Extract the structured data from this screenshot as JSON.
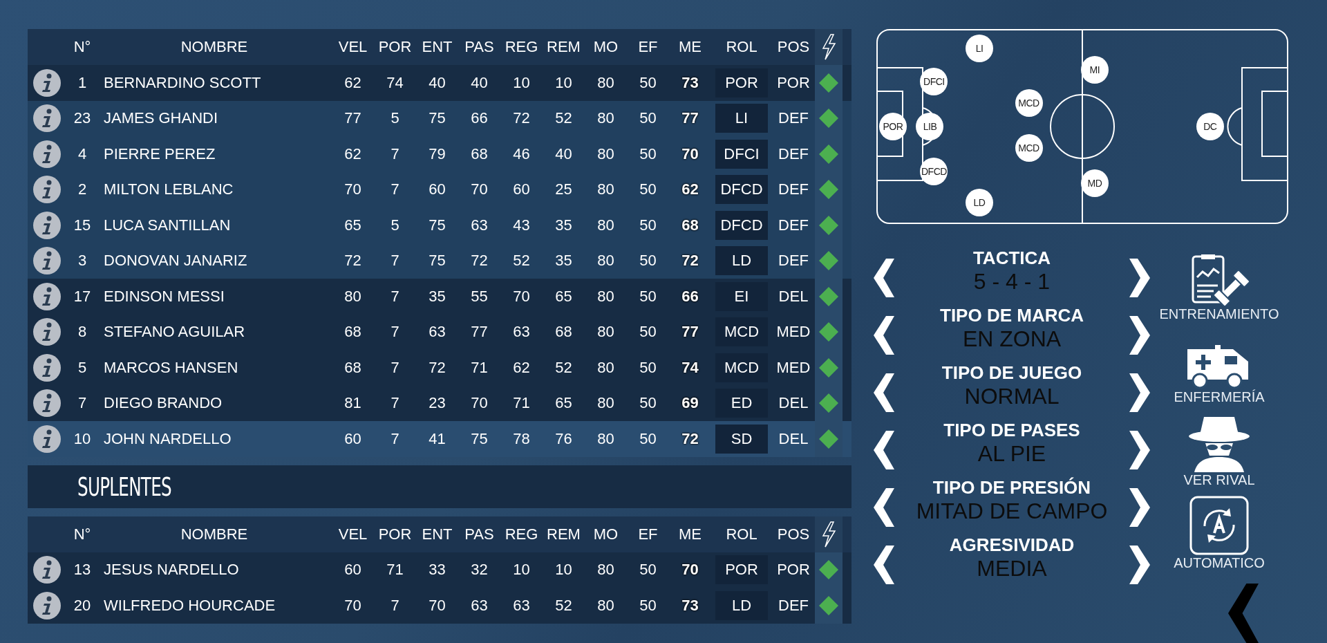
{
  "columns": [
    "N°",
    "NOMBRE",
    "VEL",
    "POR",
    "ENT",
    "PAS",
    "REG",
    "REM",
    "MO",
    "EF",
    "ME",
    "ROL",
    "POS"
  ],
  "starters": [
    {
      "number": "1",
      "name": "BERNARDINO SCOTT",
      "stats": [
        "62",
        "74",
        "40",
        "40",
        "10",
        "10",
        "80",
        "50"
      ],
      "me": "73",
      "rol": "POR",
      "pos": "POR",
      "kind": "dark"
    },
    {
      "number": "23",
      "name": "JAMES GHANDI",
      "stats": [
        "77",
        "5",
        "75",
        "66",
        "72",
        "52",
        "80",
        "50"
      ],
      "me": "77",
      "rol": "LI",
      "pos": "DEF",
      "kind": "mid"
    },
    {
      "number": "4",
      "name": "PIERRE PEREZ",
      "stats": [
        "62",
        "7",
        "79",
        "68",
        "46",
        "40",
        "80",
        "50"
      ],
      "me": "70",
      "rol": "DFCI",
      "pos": "DEF",
      "kind": "mid"
    },
    {
      "number": "2",
      "name": "MILTON LEBLANC",
      "stats": [
        "70",
        "7",
        "60",
        "70",
        "60",
        "25",
        "80",
        "50"
      ],
      "me": "62",
      "rol": "DFCD",
      "pos": "DEF",
      "kind": "mid"
    },
    {
      "number": "15",
      "name": "LUCA SANTILLAN",
      "stats": [
        "65",
        "5",
        "75",
        "63",
        "43",
        "35",
        "80",
        "50"
      ],
      "me": "68",
      "rol": "DFCD",
      "pos": "DEF",
      "kind": "mid"
    },
    {
      "number": "3",
      "name": "DONOVAN JANARIZ",
      "stats": [
        "72",
        "7",
        "75",
        "72",
        "52",
        "35",
        "80",
        "50"
      ],
      "me": "72",
      "rol": "LD",
      "pos": "DEF",
      "kind": "mid"
    },
    {
      "number": "17",
      "name": "EDINSON MESSI",
      "stats": [
        "80",
        "7",
        "35",
        "55",
        "70",
        "65",
        "80",
        "50"
      ],
      "me": "66",
      "rol": "EI",
      "pos": "DEL",
      "kind": "dark"
    },
    {
      "number": "8",
      "name": "STEFANO AGUILAR",
      "stats": [
        "68",
        "7",
        "63",
        "77",
        "63",
        "68",
        "80",
        "50"
      ],
      "me": "77",
      "rol": "MCD",
      "pos": "MED",
      "kind": "dark"
    },
    {
      "number": "5",
      "name": "MARCOS HANSEN",
      "stats": [
        "68",
        "7",
        "72",
        "71",
        "62",
        "52",
        "80",
        "50"
      ],
      "me": "74",
      "rol": "MCD",
      "pos": "MED",
      "kind": "dark"
    },
    {
      "number": "7",
      "name": "DIEGO BRANDO",
      "stats": [
        "81",
        "7",
        "23",
        "70",
        "71",
        "65",
        "80",
        "50"
      ],
      "me": "69",
      "rol": "ED",
      "pos": "DEL",
      "kind": "dark"
    },
    {
      "number": "10",
      "name": "JOHN NARDELLO",
      "stats": [
        "60",
        "7",
        "41",
        "75",
        "78",
        "76",
        "80",
        "50"
      ],
      "me": "72",
      "rol": "SD",
      "pos": "DEL",
      "kind": "light"
    }
  ],
  "subs_title": "SUPLENTES",
  "sub_columns": [
    "N°",
    "NOMBRE",
    "VEL",
    "POR",
    "ENT",
    "PAS",
    "REG",
    "REM",
    "MO",
    "EF",
    "ME",
    "ROL",
    "POS"
  ],
  "subs": [
    {
      "number": "13",
      "name": "JESUS NARDELLO",
      "stats": [
        "60",
        "71",
        "33",
        "32",
        "10",
        "10",
        "80",
        "50"
      ],
      "me": "70",
      "rol": "POR",
      "pos": "POR",
      "kind": "dark"
    },
    {
      "number": "20",
      "name": "WILFREDO HOURCADE",
      "stats": [
        "70",
        "7",
        "70",
        "63",
        "63",
        "52",
        "80",
        "50"
      ],
      "me": "73",
      "rol": "LD",
      "pos": "DEF",
      "kind": "dark"
    }
  ],
  "field_players": [
    "LI",
    "DFCI",
    "POR",
    "LIB",
    "DFCD",
    "LD",
    "MCD",
    "MCD",
    "MI",
    "MD",
    "DC"
  ],
  "settings": [
    {
      "label": "TACTICA",
      "value": "5 - 4 - 1"
    },
    {
      "label": "TIPO DE MARCA",
      "value": "EN ZONA"
    },
    {
      "label": "TIPO DE JUEGO",
      "value": "NORMAL"
    },
    {
      "label": "TIPO DE PASES",
      "value": "AL PIE"
    },
    {
      "label": "TIPO DE PRESIÓN",
      "value": "MITAD DE CAMPO"
    },
    {
      "label": "AGRESIVIDAD",
      "value": "MEDIA"
    }
  ],
  "actions": [
    {
      "kind": "training",
      "label": "ENTRENAMIENTO"
    },
    {
      "kind": "infirmary",
      "label": "ENFERMERÍA"
    },
    {
      "kind": "rival",
      "label": "VER RIVAL"
    },
    {
      "kind": "auto",
      "label": "AUTOMATICO"
    }
  ],
  "back": {
    "kind": "chevron"
  }
}
